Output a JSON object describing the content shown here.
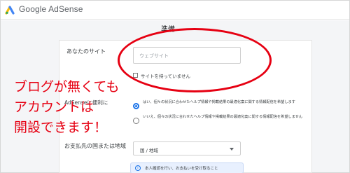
{
  "header": {
    "app_title": "Google AdSense",
    "logo_colors": [
      "#4285f4",
      "#34a853",
      "#fbbc04"
    ]
  },
  "section": {
    "title": "準備"
  },
  "site": {
    "label": "あなたのサイト",
    "placeholder": "ウェブサイト",
    "no_site_label": "サイトを持っていません",
    "no_site_checked": false
  },
  "preference": {
    "label_visible": "AdSenseに便利に",
    "options": [
      {
        "text": "はい、個々の状況に合わせたヘルプ情報や掲載結果の最適化案に関する情報配信を希望します",
        "selected": true
      },
      {
        "text": "いいえ、個々の状況に合わせたヘルプ情報や掲載結果の最適化案に関する情報配信を希望しません",
        "selected": false
      }
    ]
  },
  "payment": {
    "label": "お支払先の国または地域",
    "select_value": "国 / 地域"
  },
  "info": {
    "icon": "info-icon",
    "text": "本人確認を行い、お支払いを受け取ること"
  },
  "annotation": {
    "lines": [
      "ブログが無くても",
      "アカウントは",
      "開設できます！"
    ],
    "color": "#e60012"
  },
  "accent_color": "#1a73e8"
}
